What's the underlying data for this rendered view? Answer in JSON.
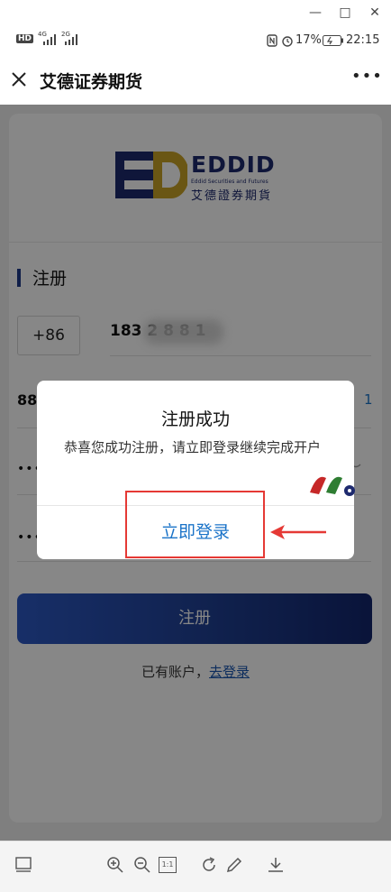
{
  "window_controls": {
    "minimize": "—",
    "maximize": "□",
    "close": "✕"
  },
  "status_bar": {
    "hd_label": "HD",
    "network_4g": "4G",
    "network_2g": "2G",
    "battery_percent": "17%",
    "time": "22:15",
    "icons": [
      "nfc-icon",
      "alarm-icon",
      "battery-charging-icon"
    ]
  },
  "header": {
    "title": "艾德证券期货",
    "more_label": "•••"
  },
  "logo": {
    "mark": "ED",
    "brand": "EDDID",
    "tagline": "Eddid Securities and Futures",
    "chinese": "艾德證券期貨",
    "colors": {
      "navy": "#1e2a6e",
      "gold": "#c9a227"
    }
  },
  "form": {
    "section_title": "注册",
    "country_code": "+86",
    "phone_visible": "183 2  8 8  1",
    "code_visible": "88",
    "resend_visible": "1",
    "password_mask": "••••",
    "password_confirm_mask": "••••",
    "register_button": "注册",
    "login_prompt": "已有账户，",
    "login_link": "去登录"
  },
  "modal": {
    "title": "注册成功",
    "message": "恭喜您成功注册，请立即登录继续完成开户",
    "action": "立即登录"
  },
  "annotation": {
    "highlight_color": "#e53935"
  },
  "toolbar": {
    "icons": [
      "panel-icon",
      "zoom-in-icon",
      "zoom-out-icon",
      "actual-size-icon",
      "rotate-icon",
      "edit-icon",
      "download-icon"
    ],
    "actual_size_label": "1:1"
  },
  "accent_color": "#1a73c8"
}
